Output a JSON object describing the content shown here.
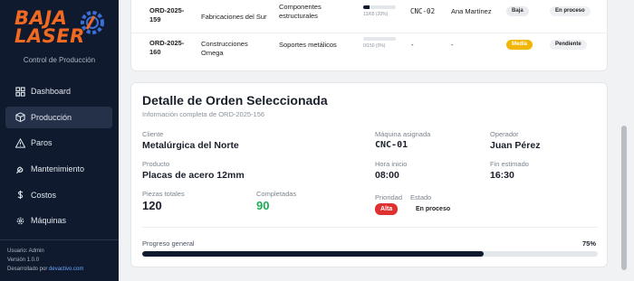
{
  "app": {
    "logo_line1": "BAJA",
    "logo_line2": "LASER",
    "subtitle": "Control de Producción",
    "brand_color": "#f26a21"
  },
  "sidebar": {
    "items": [
      {
        "label": "Dashboard",
        "icon": "grid-icon",
        "active": false
      },
      {
        "label": "Producción",
        "icon": "box-icon",
        "active": true
      },
      {
        "label": "Paros",
        "icon": "warning-icon",
        "active": false
      },
      {
        "label": "Mantenimiento",
        "icon": "wrench-icon",
        "active": false
      },
      {
        "label": "Costos",
        "icon": "dollar-icon",
        "active": false
      },
      {
        "label": "Máquinas",
        "icon": "gear-icon",
        "active": false
      }
    ],
    "user": "Usuario: Admin",
    "version": "Versión 1.0.0",
    "dev_prefix": "Desarrollado por ",
    "dev_link": "devactivo.com"
  },
  "orders": [
    {
      "order_l1": "ORD-2025-",
      "order_l2": "159",
      "client": "Fabricaciones del Sur",
      "product_l1": "Componentes",
      "product_l2": "estructurales",
      "progress_fraction": 0.2,
      "progress_text": "13/65 (20%)",
      "machine": "CNC-02",
      "operator": "Ana Martínez",
      "priority": "Baja",
      "priority_color": "#e9ebee",
      "status": "En proceso"
    },
    {
      "order_l1": "ORD-2025-",
      "order_l2": "160",
      "client_l1": "Construcciones",
      "client_l2": "Omega",
      "product": "Soportes metálicos",
      "progress_fraction": 0,
      "progress_text": "0/150 (0%)",
      "machine": "-",
      "operator": "-",
      "priority": "Media",
      "priority_color": "#f2b705",
      "status": "Pendiente"
    }
  ],
  "detail": {
    "title": "Detalle de Orden Seleccionada",
    "subtitle": "Información completa de ORD-2025-156",
    "cliente_label": "Cliente",
    "cliente": "Metalúrgica del Norte",
    "producto_label": "Producto",
    "producto": "Placas de acero 12mm",
    "piezas_label": "Piezas totales",
    "piezas": "120",
    "completadas_label": "Completadas",
    "completadas": "90",
    "maquina_label": "Máquina asignada",
    "maquina": "CNC-01",
    "hora_label": "Hora inicio",
    "hora": "08:00",
    "prioridad_label": "Prioridad",
    "prioridad": "Alta",
    "prioridad_color": "#e03131",
    "estado_label": "Estado",
    "estado": "En proceso",
    "operador_label": "Operador",
    "operador": "Juan Pérez",
    "fin_label": "Fin estimado",
    "fin": "16:30",
    "progreso_label": "Progreso general",
    "progreso_text": "75%",
    "progreso_fraction": 0.75
  }
}
